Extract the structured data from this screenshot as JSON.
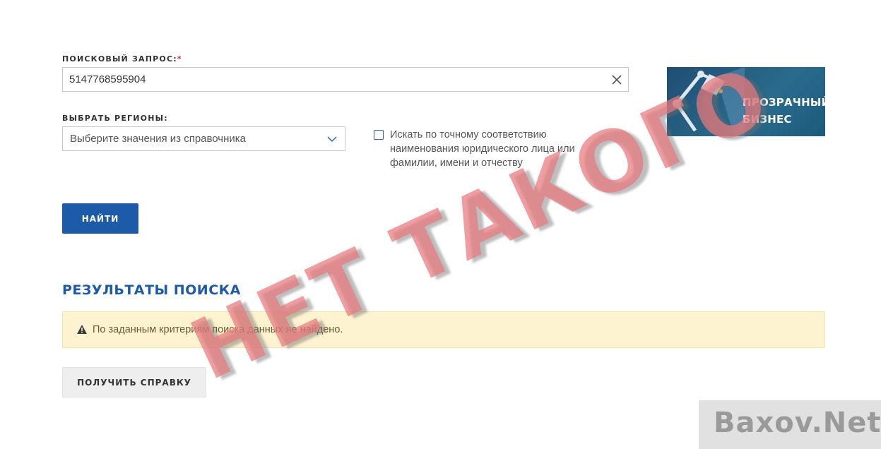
{
  "form": {
    "query_label": "ПОИСКОВЫЙ ЗАПРОС:",
    "required_mark": "*",
    "query_value": "5147768595904",
    "regions_label": "ВЫБРАТЬ РЕГИОНЫ:",
    "regions_placeholder": "Выберите значения из справочника",
    "exact_match_label": "Искать по точному соответствию наименования юридического лица или фамилии, имени и отчеству",
    "exact_match_checked": false,
    "find_button": "НАЙТИ"
  },
  "banner": {
    "line1": "ПРОЗРАЧНЫЙ",
    "line2": "БИЗНЕС",
    "icon": "lamp-icon"
  },
  "results": {
    "title": "РЕЗУЛЬТАТЫ ПОИСКА",
    "message": "По заданным критериям поиска данных не найдено.",
    "icon": "warning-icon",
    "certificate_button": "ПОЛУЧИТЬ СПРАВКУ"
  },
  "overlay": {
    "stamp_text": "НЕТ ТАКОГО",
    "watermark": "Baxov.Net"
  },
  "colors": {
    "accent": "#1d5aa8",
    "alert_bg": "#fdf3d0",
    "required": "#d9262e"
  }
}
